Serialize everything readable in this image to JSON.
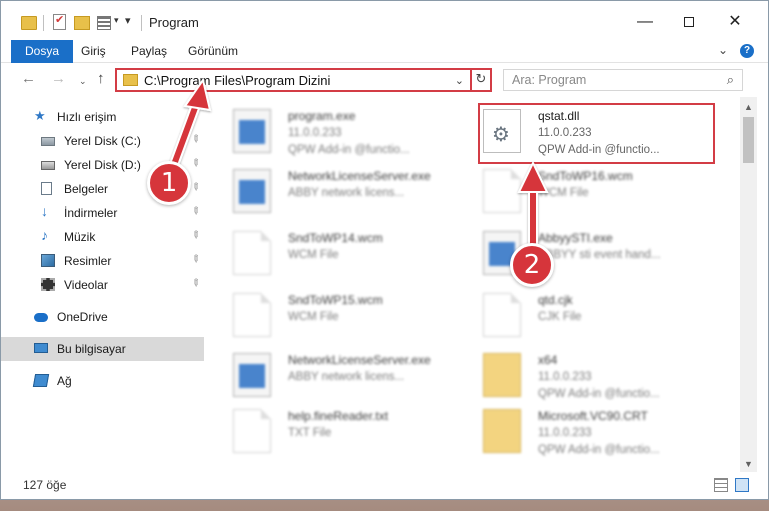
{
  "window": {
    "title": "Program",
    "minimize_glyph": "—",
    "close_glyph": "✕"
  },
  "ribbon": {
    "tabs": [
      "Dosya",
      "Giriş",
      "Paylaş",
      "Görünüm"
    ],
    "active_tab": "Dosya",
    "help_glyph": "?",
    "collapse_glyph": "⌄"
  },
  "navigation": {
    "back_glyph": "←",
    "forward_glyph": "→",
    "up_glyph": "↑",
    "recent_glyph": "⌄",
    "address": "C:\\Program Files\\Program Dizini",
    "refresh_glyph": "↻",
    "search_placeholder": "Ara: Program",
    "search_glyph": "⌕"
  },
  "sidebar": {
    "quick_access": "Hızlı erişim",
    "items": [
      {
        "label": "Yerel Disk (C:)",
        "icon": "drive-icon",
        "pinned": true
      },
      {
        "label": "Yerel Disk (D:)",
        "icon": "drive-icon",
        "pinned": true
      },
      {
        "label": "Belgeler",
        "icon": "documents-icon",
        "pinned": true
      },
      {
        "label": "İndirmeler",
        "icon": "downloads-icon",
        "pinned": true
      },
      {
        "label": "Müzik",
        "icon": "music-icon",
        "pinned": true
      },
      {
        "label": "Resimler",
        "icon": "pictures-icon",
        "pinned": true
      },
      {
        "label": "Videolar",
        "icon": "videos-icon",
        "pinned": true
      }
    ],
    "onedrive": "OneDrive",
    "this_pc": "Bu bilgisayar",
    "network": "Ağ",
    "pin_glyph": "📌"
  },
  "files": [
    {
      "name": "program.exe",
      "version": "11.0.0.233",
      "desc": "QPW Add-in @functio...",
      "icon": "exe"
    },
    {
      "name": "qstat.dll",
      "version": "11.0.0.233",
      "desc": "QPW Add-in @functio...",
      "icon": "dll",
      "highlight": true
    },
    {
      "name": "NetworkLicenseServer.exe",
      "version": "",
      "desc": "ABBY network licens...",
      "icon": "app"
    },
    {
      "name": "SndToWP16.wcm",
      "version": "",
      "desc": "WCM File",
      "icon": "page"
    },
    {
      "name": "SndToWP14.wcm",
      "version": "",
      "desc": "WCM File",
      "icon": "page"
    },
    {
      "name": "AbbyySTI.exe",
      "version": "",
      "desc": "ABBYY sti event hand...",
      "icon": "app"
    },
    {
      "name": "SndToWP15.wcm",
      "version": "",
      "desc": "WCM File",
      "icon": "page"
    },
    {
      "name": "qtd.cjk",
      "version": "",
      "desc": "CJK File",
      "icon": "page"
    },
    {
      "name": "NetworkLicenseServer.exe",
      "version": "",
      "desc": "ABBY network licens...",
      "icon": "app"
    },
    {
      "name": "x64",
      "version": "11.0.0.233",
      "desc": "QPW Add-in @functio...",
      "icon": "folder"
    },
    {
      "name": "help.fineReader.txt",
      "version": "",
      "desc": "TXT File",
      "icon": "page"
    },
    {
      "name": "Microsoft.VC90.CRT",
      "version": "11.0.0.233",
      "desc": "QPW Add-in @functio...",
      "icon": "folder"
    }
  ],
  "status": {
    "item_count": "127 öğe"
  },
  "annotations": {
    "step1": "1",
    "step2": "2",
    "accent": "#d6353b"
  },
  "colors": {
    "ribbon_active": "#1a6fc8",
    "highlight_border": "#d33c45"
  }
}
